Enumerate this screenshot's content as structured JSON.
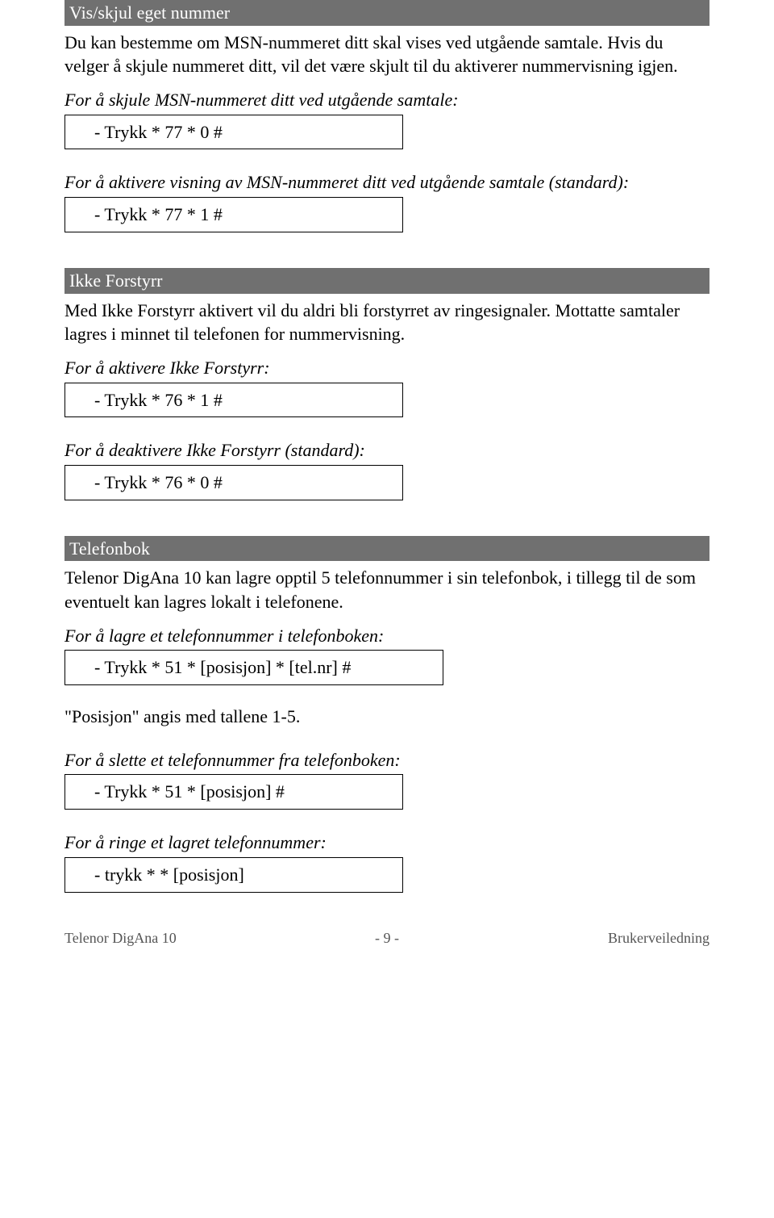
{
  "sec1": {
    "title": "Vis/skjul eget nummer",
    "para": "Du kan bestemme om MSN-nummeret ditt skal vises ved utgående samtale. Hvis du velger å skjule nummeret ditt, vil det være skjult til du aktiverer nummervisning igjen.",
    "instr1": "For å skjule MSN-nummeret ditt ved utgående samtale:",
    "code1": "- Trykk  * 77 * 0 #",
    "instr2": "For å aktivere visning av MSN-nummeret ditt ved utgående samtale (standard):",
    "code2": "- Trykk  * 77 * 1 #"
  },
  "sec2": {
    "title": "Ikke Forstyrr",
    "para": "Med Ikke Forstyrr aktivert vil du aldri bli forstyrret av ringesignaler. Mottatte samtaler lagres i minnet til telefonen for nummervisning.",
    "instr1": "For å aktivere Ikke Forstyrr:",
    "code1": "- Trykk  * 76 * 1 #",
    "instr2": "For å deaktivere Ikke Forstyrr (standard):",
    "code2": "- Trykk  * 76 * 0 #"
  },
  "sec3": {
    "title": "Telefonbok",
    "para": "Telenor DigAna 10 kan lagre opptil 5 telefonnummer i sin telefonbok, i tillegg til de som eventuelt kan lagres lokalt i telefonene.",
    "instr1": "For å lagre et telefonnummer i telefonboken:",
    "code1": "- Trykk  * 51 * [posisjon] * [tel.nr] #",
    "note": "\"Posisjon\" angis med tallene 1-5.",
    "instr2": "For å slette et telefonnummer fra telefonboken:",
    "code2": "- Trykk  * 51 * [posisjon] #",
    "instr3": "For å ringe et lagret telefonnummer:",
    "code3": "- trykk  * * [posisjon]"
  },
  "footer": {
    "left": "Telenor DigAna 10",
    "center": "- 9 -",
    "right": "Brukerveiledning"
  }
}
